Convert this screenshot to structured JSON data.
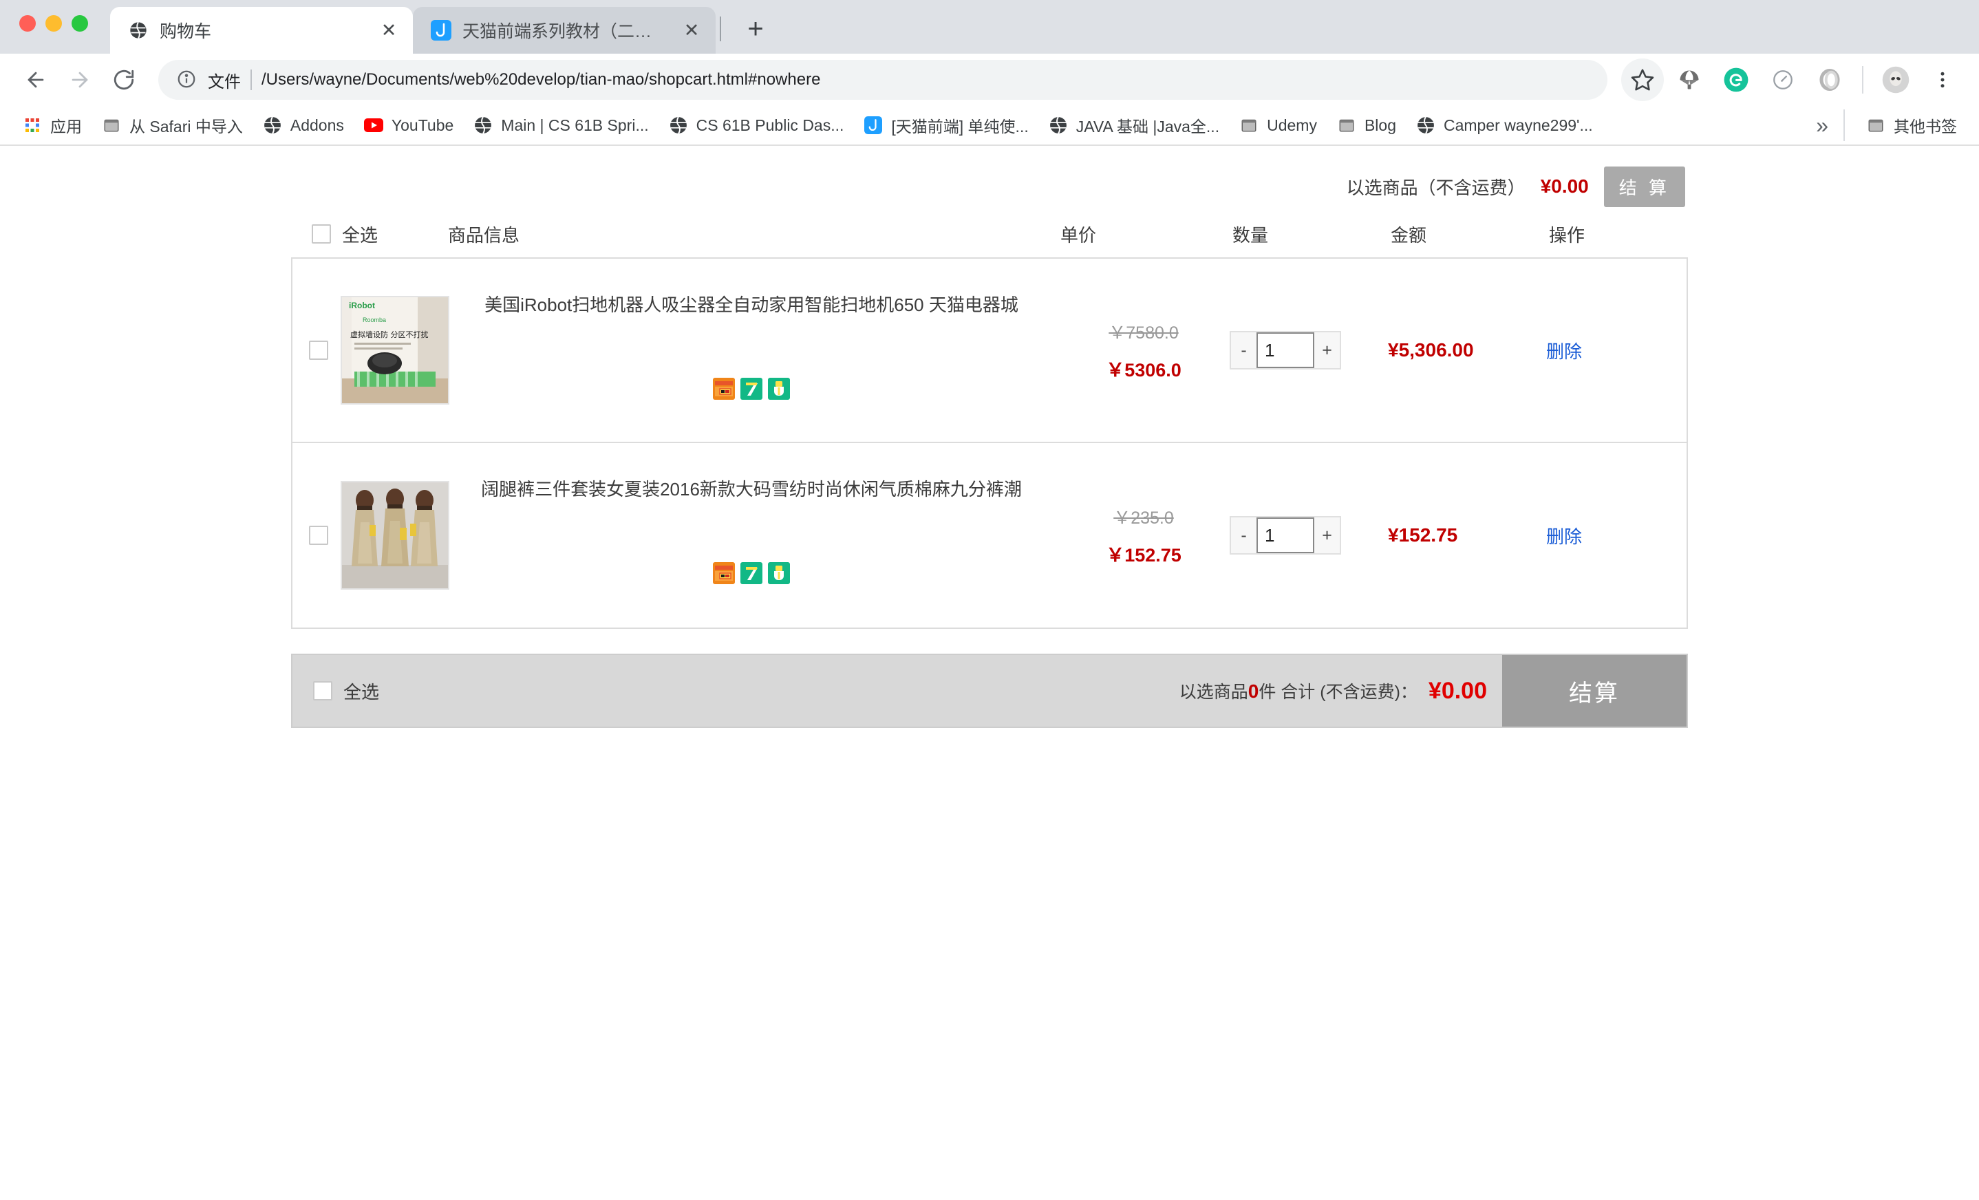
{
  "browser": {
    "tabs": [
      {
        "title": "购物车",
        "favicon": "globe-icon",
        "active": true
      },
      {
        "title": "天猫前端系列教材（二十九）- 贝",
        "favicon": "juejin-icon",
        "active": false
      }
    ],
    "newtab_label": "+",
    "close_label": "✕",
    "omnibox": {
      "scheme_label": "文件",
      "url": "/Users/wayne/Documents/web%20develop/tian-mao/shopcart.html#nowhere",
      "info_icon": "info-icon"
    },
    "toolbar_icons": [
      "star-icon",
      "parachute-icon",
      "grammarly-icon",
      "speedometer-icon",
      "ring-icon",
      "profile-avatar-icon",
      "more-menu-icon"
    ],
    "bookmarks": [
      {
        "label": "应用",
        "icon": "apps-grid-icon"
      },
      {
        "label": "从 Safari 中导入",
        "icon": "folder-icon"
      },
      {
        "label": "Addons",
        "icon": "globe-icon"
      },
      {
        "label": "YouTube",
        "icon": "youtube-icon"
      },
      {
        "label": "Main | CS 61B Spri...",
        "icon": "globe-icon"
      },
      {
        "label": "CS 61B Public Das...",
        "icon": "globe-icon"
      },
      {
        "label": "[天猫前端] 单纯使...",
        "icon": "juejin-icon"
      },
      {
        "label": "JAVA 基础 |Java全...",
        "icon": "globe-icon"
      },
      {
        "label": "Udemy",
        "icon": "folder-icon"
      },
      {
        "label": "Blog",
        "icon": "folder-icon"
      },
      {
        "label": "Camper wayne299'...",
        "icon": "globe-icon"
      }
    ],
    "bookmarks_overflow": "»",
    "other_bookmarks": {
      "label": "其他书签",
      "icon": "folder-icon"
    }
  },
  "cart": {
    "topbar": {
      "label": "以选商品（不含运费）",
      "amount": "¥0.00",
      "checkout_label": "结 算"
    },
    "headers": {
      "select_all": "全选",
      "product_info": "商品信息",
      "unit_price": "单价",
      "quantity": "数量",
      "subtotal": "金额",
      "operation": "操作"
    },
    "items": [
      {
        "title": "美国iRobot扫地机器人吸尘器全自动家用智能扫地机650 天猫电器城",
        "thumb": "irobot-vacuum-photo",
        "badges": [
          "credit-card-badge",
          "seven-day-return-badge",
          "authentic-guarantee-badge"
        ],
        "price_old": "￥7580.0",
        "price_new": "￥5306.0",
        "qty": "1",
        "minus_label": "-",
        "plus_label": "+",
        "subtotal": "¥5,306.00",
        "delete_label": "删除"
      },
      {
        "title": "阔腿裤三件套装女夏装2016新款大码雪纺时尚休闲气质棉麻九分裤潮",
        "thumb": "womens-pants-photo",
        "badges": [
          "credit-card-badge",
          "seven-day-return-badge",
          "authentic-guarantee-badge"
        ],
        "price_old": "￥235.0",
        "price_new": "￥152.75",
        "qty": "1",
        "minus_label": "-",
        "plus_label": "+",
        "subtotal": "¥152.75",
        "delete_label": "删除"
      }
    ],
    "footer": {
      "select_all": "全选",
      "summary_prefix": "以选商品",
      "summary_count": "0",
      "summary_suffix": "件 合计 (不含运费)：",
      "total": "¥0.00",
      "checkout_label": "结算"
    }
  },
  "colors": {
    "price_red": "#c00000",
    "link_blue": "#1a5cd6",
    "button_gray": "#9e9e9e",
    "footer_bg": "#d8d8d8"
  }
}
